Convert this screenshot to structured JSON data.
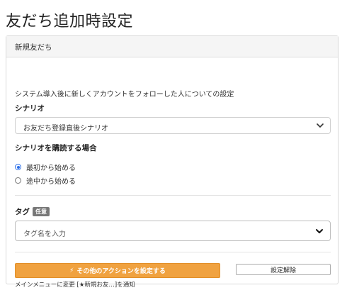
{
  "page": {
    "title": "友だち追加時設定"
  },
  "panel": {
    "header": "新規友だち",
    "description": "システム導入後に新しくアカウントをフォローした人についての設定",
    "scenario": {
      "label": "シナリオ",
      "selected": "お友だち登録直後シナリオ"
    },
    "subscribe": {
      "label": "シナリオを購読する場合",
      "options": [
        {
          "label": "最初から始める",
          "checked": true
        },
        {
          "label": "途中から始める",
          "checked": false
        }
      ]
    },
    "tag": {
      "label": "タグ",
      "badge": "任意",
      "placeholder": "タグ名を入力"
    },
    "actions": {
      "other_actions_label": "その他のアクションを設定する",
      "reset_label": "設定解除",
      "note": "メインメニューに変更 [★新規お友…]を通知"
    }
  },
  "colors": {
    "accent": "#f0a240",
    "radio": "#2a6ee8",
    "badge": "#777777"
  }
}
